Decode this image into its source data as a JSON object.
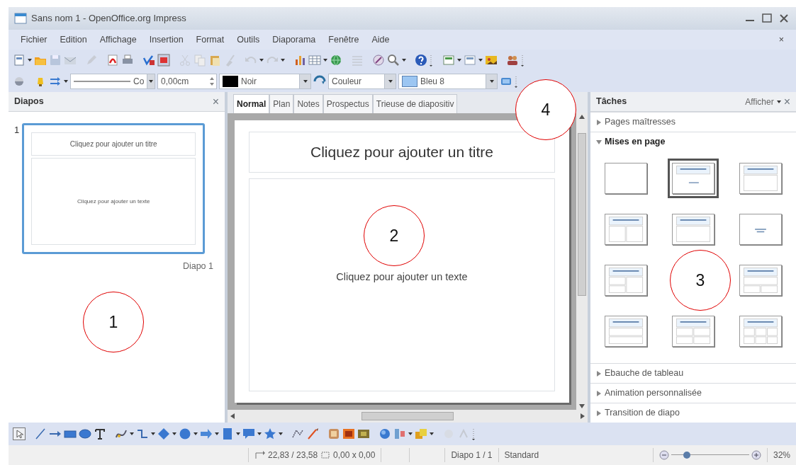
{
  "window": {
    "title": "Sans nom 1 - OpenOffice.org Impress"
  },
  "menu": [
    {
      "label": "Fichier"
    },
    {
      "label": "Edition"
    },
    {
      "label": "Affichage"
    },
    {
      "label": "Insertion"
    },
    {
      "label": "Format"
    },
    {
      "label": "Outils"
    },
    {
      "label": "Diaporama"
    },
    {
      "label": "Fenêtre"
    },
    {
      "label": "Aide"
    }
  ],
  "menu_close": "×",
  "line_toolbar": {
    "line_style": "Co",
    "line_width": "0,00cm",
    "line_color": {
      "value": "Noir",
      "color": "#000000"
    },
    "area_style": "Couleur",
    "area_fill": {
      "value": "Bleu 8",
      "color": "#9cc6f2"
    }
  },
  "slides_pane": {
    "title": "Diapos",
    "close": "×",
    "slides": [
      {
        "number": "1",
        "title": "Cliquez pour ajouter un titre",
        "text": "Cliquez pour ajouter un texte",
        "label": "Diapo 1",
        "selected": true
      }
    ]
  },
  "view_tabs": [
    {
      "label": "Normal",
      "selected": true
    },
    {
      "label": "Plan",
      "selected": false
    },
    {
      "label": "Notes",
      "selected": false
    },
    {
      "label": "Prospectus",
      "selected": false
    },
    {
      "label": "Trieuse de diapositiv",
      "selected": false
    }
  ],
  "slide": {
    "title": "Cliquez pour ajouter un titre",
    "text": "Cliquez pour ajouter un texte"
  },
  "tasks_pane": {
    "title": "Tâches",
    "view_menu": "Afficher",
    "close": "×",
    "sections": [
      {
        "label": "Pages maîtresses",
        "expanded": false
      },
      {
        "label": "Mises en page",
        "expanded": true,
        "layouts": [
          {
            "kind": "blank",
            "selected": false
          },
          {
            "kind": "title-content",
            "selected": true
          },
          {
            "kind": "title-only",
            "selected": false
          },
          {
            "kind": "title-2col",
            "selected": false
          },
          {
            "kind": "title-only",
            "selected": false
          },
          {
            "kind": "centered",
            "selected": false
          },
          {
            "kind": "title-2row-col",
            "selected": false
          },
          {
            "kind": "title-col-2row",
            "selected": false
          },
          {
            "kind": "title-2row",
            "selected": false
          },
          {
            "kind": "title-4",
            "selected": false
          },
          {
            "kind": "title-6",
            "selected": false
          }
        ]
      },
      {
        "label": "Ebauche de tableau",
        "expanded": false
      },
      {
        "label": "Animation personnalisée",
        "expanded": false
      },
      {
        "label": "Transition de diapo",
        "expanded": false
      }
    ]
  },
  "status_bar": {
    "position": "22,83 / 23,58",
    "size": "0,00 x 0,00",
    "slide": "Diapo 1 / 1",
    "master": "Standard",
    "zoom": {
      "level": 0.2
    },
    "zoom_reading": "32%"
  },
  "annotations": [
    {
      "label": "1"
    },
    {
      "label": "2"
    },
    {
      "label": "3"
    },
    {
      "label": "4"
    }
  ]
}
